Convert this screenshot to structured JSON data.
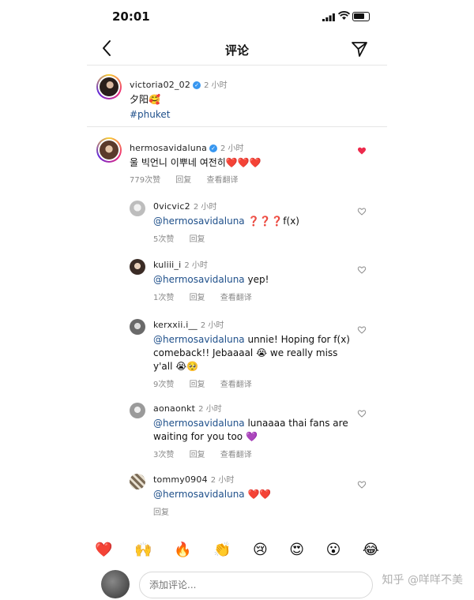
{
  "status_bar": {
    "time": "20:01"
  },
  "nav": {
    "title": "评论"
  },
  "caption": {
    "username": "victoria02_02",
    "verified": true,
    "time": "2 小时",
    "text": "夕阳🥰",
    "hashtag": "#phuket"
  },
  "top_comment": {
    "username": "hermosavidaluna",
    "verified": true,
    "time": "2 小时",
    "text": "울 빅언니 이뿌네 여전히❤️❤️❤️",
    "likes": "779次赞",
    "reply": "回复",
    "translate": "查看翻译",
    "liked": true
  },
  "replies": [
    {
      "username": "0vicvic2",
      "time": "2 小时",
      "mention": "@hermosavidaluna",
      "text": " ❓❓❓f(x)",
      "likes": "5次赞",
      "reply": "回复",
      "translate": ""
    },
    {
      "username": "kuliii_i",
      "time": "2 小时",
      "mention": "@hermosavidaluna",
      "text": " yep!",
      "likes": "1次赞",
      "reply": "回复",
      "translate": "查看翻译"
    },
    {
      "username": "kerxxii.i__",
      "time": "2 小时",
      "mention": "@hermosavidaluna",
      "text": " unnie! Hoping for f(x) comeback!! Jebaaaal 😭 we really miss y'all 😭🥺",
      "likes": "9次赞",
      "reply": "回复",
      "translate": "查看翻译"
    },
    {
      "username": "aonaonkt",
      "time": "2 小时",
      "mention": "@hermosavidaluna",
      "text": " lunaaaa thai fans are waiting for you too 💜",
      "likes": "3次赞",
      "reply": "回复",
      "translate": "查看翻译"
    },
    {
      "username": "tommy0904",
      "time": "2 小时",
      "mention": "@hermosavidaluna",
      "text": " ❤️❤️",
      "likes": "",
      "reply": "回复",
      "translate": ""
    }
  ],
  "emoji_bar": [
    "❤️",
    "🙌",
    "🔥",
    "👏",
    "😢",
    "😍",
    "😮",
    "😂"
  ],
  "composer": {
    "placeholder": "添加评论..."
  },
  "watermark": "知乎 @咩咩不美"
}
